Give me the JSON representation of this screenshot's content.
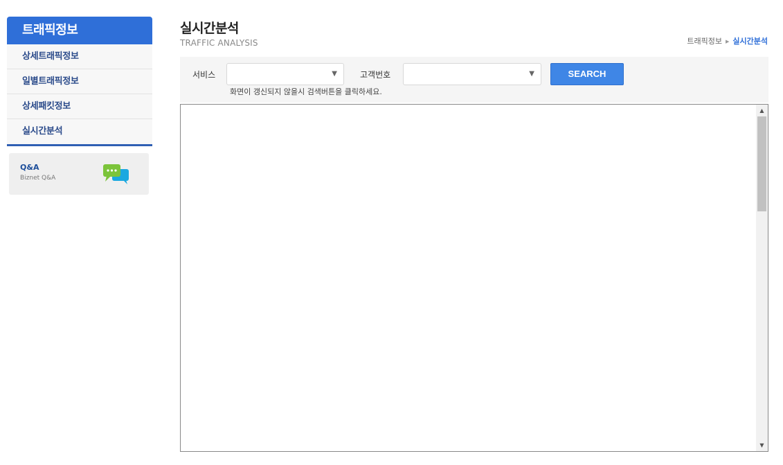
{
  "sidebar": {
    "header": "트래픽정보",
    "items": [
      {
        "label": "상세트래픽정보"
      },
      {
        "label": "일별트래픽정보"
      },
      {
        "label": "상세패킷정보"
      },
      {
        "label": "실시간분석"
      }
    ],
    "qna": {
      "title": "Q&A",
      "subtitle": "Biznet Q&A",
      "icon": "chat-bubbles-icon"
    }
  },
  "header": {
    "title": "실시간분석",
    "subtitle": "TRAFFIC ANALYSIS",
    "breadcrumb": {
      "parent": "트래픽정보",
      "current": "실시간분석"
    }
  },
  "search": {
    "service_label": "서비스",
    "service_value": "",
    "customer_label": "고객번호",
    "customer_value": "",
    "button_label": "SEARCH",
    "note": "화면이 갱신되지 않을시 검색버튼을 클릭하세요."
  },
  "colors": {
    "accent": "#2f6fd8",
    "button": "#3f86e6",
    "panel": "#f5f5f5"
  }
}
